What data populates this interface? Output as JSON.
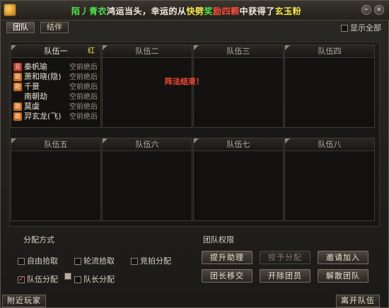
{
  "marquee": {
    "parts": [
      {
        "text": "陌丿青衣",
        "color": "green"
      },
      {
        "text": "鸿运当头，幸运的从",
        "color": "white"
      },
      {
        "text": "快劈",
        "color": "yellow"
      },
      {
        "text": "奖",
        "color": "green"
      },
      {
        "text": "励四颗",
        "color": "red"
      },
      {
        "text": "中获得了",
        "color": "white"
      },
      {
        "text": "玄玉粉",
        "color": "yellow"
      }
    ]
  },
  "tabs": [
    {
      "label": "团队",
      "active": true
    },
    {
      "label": "结伴",
      "active": false
    }
  ],
  "show_all_label": "显示全部",
  "teams_top": [
    {
      "label": "队伍一",
      "selected": true,
      "leader_mark": "红"
    },
    {
      "label": "队伍二",
      "selected": false
    },
    {
      "label": "队伍三",
      "selected": false
    },
    {
      "label": "队伍四",
      "selected": false
    }
  ],
  "teams_bottom": [
    {
      "label": "队伍五"
    },
    {
      "label": "队伍六"
    },
    {
      "label": "队伍七"
    },
    {
      "label": "队伍八"
    }
  ],
  "members": [
    {
      "name": "秦帆瑜",
      "skill": "空前绝后",
      "badge": "旦",
      "badge_color": "#b8392b"
    },
    {
      "name": "萧和晓(隐)",
      "skill": "空前绝后",
      "badge": "助",
      "badge_color": "#c96a1a"
    },
    {
      "name": "千景",
      "skill": "空前绝后",
      "badge": "助",
      "badge_color": "#c96a1a"
    },
    {
      "name": "南朝劫",
      "skill": "空前绝后",
      "badge": "",
      "badge_color": ""
    },
    {
      "name": "莫虞",
      "skill": "空前绝后",
      "badge": "助",
      "badge_color": "#c96a1a"
    },
    {
      "name": "羿玄龙(飞)",
      "skill": "空前绝后",
      "badge": "助",
      "badge_color": "#c96a1a"
    }
  ],
  "notice": "阵法结束！",
  "distribution": {
    "title": "分配方式",
    "options": [
      {
        "label": "自由拾取",
        "checked": false
      },
      {
        "label": "轮流拾取",
        "checked": false
      },
      {
        "label": "竞拍分配",
        "checked": false
      },
      {
        "label": "队伍分配",
        "checked": true
      },
      {
        "label": "队长分配",
        "checked": false
      }
    ]
  },
  "permissions": {
    "title": "团队权限",
    "buttons": [
      {
        "label": "提升助理",
        "enabled": true
      },
      {
        "label": "授予分配",
        "enabled": false
      },
      {
        "label": "邀请加入",
        "enabled": true
      },
      {
        "label": "团长移交",
        "enabled": true
      },
      {
        "label": "开除团员",
        "enabled": true
      },
      {
        "label": "解散团队",
        "enabled": true
      }
    ]
  },
  "footer": {
    "nearby_label": "附近玩家",
    "leave_label": "离开队伍"
  },
  "colors": {
    "green": "#4ce44c",
    "yellow": "#f3e54a",
    "red": "#ff4d3a",
    "white": "#f2ece0"
  }
}
